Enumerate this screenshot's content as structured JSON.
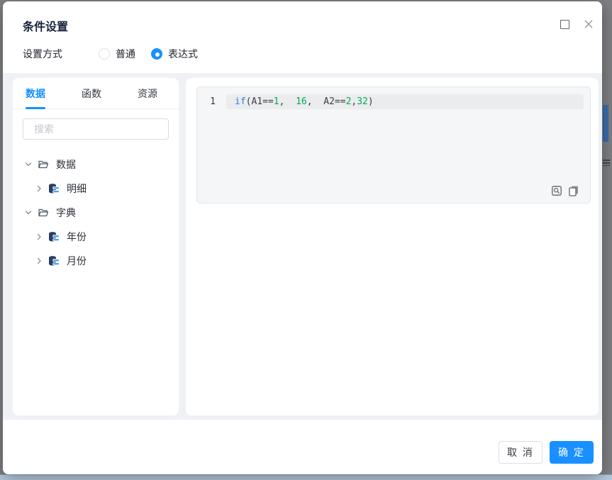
{
  "colors": {
    "accent": "#1890ff",
    "keyword": "#2f7bf5",
    "number": "#00a854"
  },
  "dialog": {
    "title": "条件设置",
    "window_controls": [
      {
        "icon": "maximize-icon"
      },
      {
        "icon": "close-icon"
      }
    ],
    "mode": {
      "label": "设置方式",
      "options": [
        {
          "label": "普通",
          "selected": false
        },
        {
          "label": "表达式",
          "selected": true
        }
      ]
    },
    "left_panel": {
      "tabs": [
        {
          "label": "数据",
          "active": true
        },
        {
          "label": "函数",
          "active": false
        },
        {
          "label": "资源",
          "active": false
        }
      ],
      "search_placeholder": "搜索",
      "tree": [
        {
          "label": "数据",
          "type": "folder",
          "expanded": true,
          "children": [
            {
              "label": "明细",
              "type": "dataset"
            }
          ]
        },
        {
          "label": "字典",
          "type": "folder",
          "expanded": true,
          "children": [
            {
              "label": "年份",
              "type": "dataset"
            },
            {
              "label": "月份",
              "type": "dataset"
            }
          ]
        }
      ]
    },
    "editor": {
      "line_number": "1",
      "code": "if(A1==1,  16,  A2==2,32)",
      "tokens": [
        {
          "text": "if",
          "type": "keyword"
        },
        {
          "text": "(A1==",
          "type": "plain"
        },
        {
          "text": "1",
          "type": "number"
        },
        {
          "text": ",  ",
          "type": "plain"
        },
        {
          "text": "16",
          "type": "number"
        },
        {
          "text": ",  ",
          "type": "plain"
        },
        {
          "text": "A2==",
          "type": "plain"
        },
        {
          "text": "2",
          "type": "number"
        },
        {
          "text": ",",
          "type": "plain"
        },
        {
          "text": "32",
          "type": "number"
        },
        {
          "text": ")",
          "type": "plain"
        }
      ],
      "actions": [
        {
          "icon": "preview-icon"
        },
        {
          "icon": "copy-icon"
        }
      ]
    },
    "footer": {
      "cancel": "取 消",
      "confirm": "确 定"
    }
  }
}
